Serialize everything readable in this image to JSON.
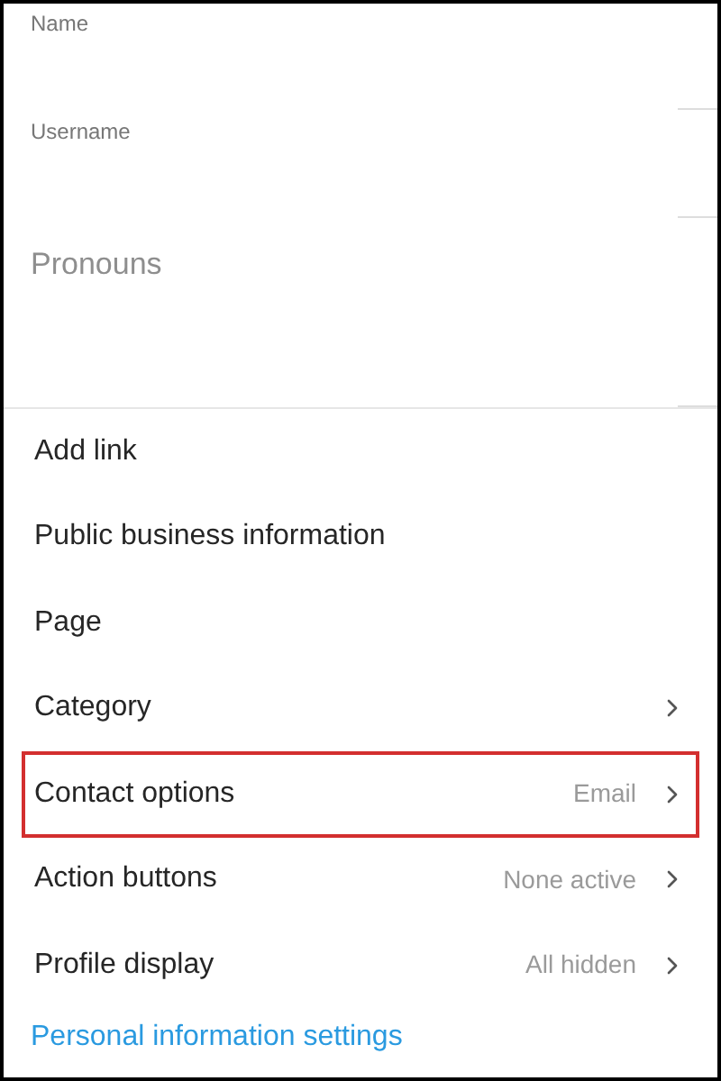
{
  "fields": [
    {
      "label": "Name",
      "kind": "small"
    },
    {
      "label": "Username",
      "kind": "small"
    },
    {
      "label": "Pronouns",
      "kind": "large"
    }
  ],
  "rows": [
    {
      "label": "Add link",
      "kind": "plain",
      "highlighted": false
    },
    {
      "label": "Public business information",
      "kind": "heading",
      "highlighted": false
    },
    {
      "label": "Page",
      "kind": "plain",
      "highlighted": false
    },
    {
      "label": "Category",
      "kind": "nav",
      "highlighted": false
    },
    {
      "label": "Contact options",
      "value": "Email",
      "kind": "nav",
      "highlighted": true
    },
    {
      "label": "Action buttons",
      "value": "None active",
      "kind": "nav",
      "highlighted": false
    },
    {
      "label": "Profile display",
      "value": "All hidden",
      "kind": "nav",
      "highlighted": false
    }
  ],
  "footer_link": "Personal information settings"
}
